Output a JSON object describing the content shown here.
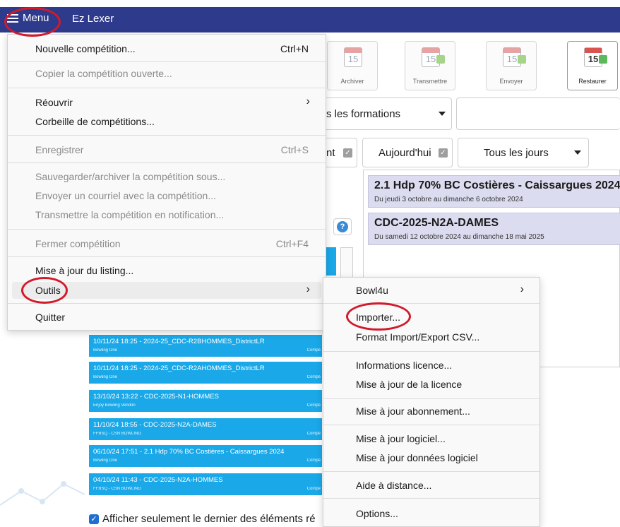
{
  "titlebar": {
    "menu_label": "Menu",
    "app_title": "Ez Lexer"
  },
  "toolbar": [
    {
      "name": "archiver",
      "label": "Archiver",
      "day": "15"
    },
    {
      "name": "transmettre",
      "label": "Transmettre",
      "day": "15"
    },
    {
      "name": "envoyer",
      "label": "Envoyer",
      "day": "15"
    },
    {
      "name": "restaurer",
      "label": "Restaurer",
      "day": "15"
    }
  ],
  "filters": {
    "formations": "s les formations",
    "partial_left": "nt",
    "today": "Aujourd'hui",
    "days": "Tous les jours"
  },
  "competitions": [
    {
      "title": "2.1 Hdp 70% BC Costières - Caissargues 2024",
      "dates": "Du jeudi 3 octobre au dimanche 6 octobre 2024"
    },
    {
      "title": "CDC-2025-N2A-DAMES",
      "dates": "Du samedi 12 octobre 2024 au dimanche 18 mai 2025"
    }
  ],
  "help_glyph": "?",
  "recent_items": [
    {
      "title": "10/11/24 18:25 - 2024-25_CDC-R2BHOMMES_DistrictLR",
      "sub": "Bowling One",
      "right": "Compé"
    },
    {
      "title": "10/11/24 18:25 - 2024-25_CDC-R2AHOMMES_DistrictLR",
      "sub": "Bowling One",
      "right": "Compé"
    },
    {
      "title": "13/10/24 13:22 - CDC-2025-N1-HOMMES",
      "sub": "Enjoy Bowling Vendon",
      "right": "Compé"
    },
    {
      "title": "11/10/24 18:55 - CDC-2025-N2A-DAMES",
      "sub": "FFBSQ - CSN BOWLING",
      "right": "Compé"
    },
    {
      "title": "06/10/24 17:51 - 2.1 Hdp 70% BC Costières - Caissargues 2024",
      "sub": "Bowling One",
      "right": "Compé"
    },
    {
      "title": "04/10/24 11:43 - CDC-2025-N2A-HOMMES",
      "sub": "FFBSQ - CSN BOWLING",
      "right": "Compé"
    }
  ],
  "footer": {
    "show_last_label": "Afficher seulement le dernier des éléments ré"
  },
  "main_menu": {
    "items": [
      {
        "label": "Nouvelle compétition...",
        "shortcut": "Ctrl+N",
        "disabled": false
      },
      {
        "label": "Copier la compétition ouverte...",
        "disabled": true
      },
      {
        "label": "Réouvrir",
        "submenu": true
      },
      {
        "label": "Corbeille de compétitions..."
      },
      {
        "label": "Enregistrer",
        "shortcut": "Ctrl+S",
        "disabled": true
      },
      {
        "label": "Sauvegarder/archiver la compétition sous...",
        "disabled": true
      },
      {
        "label": "Envoyer un courriel avec la compétition...",
        "disabled": true
      },
      {
        "label": "Transmettre la compétition en notification...",
        "disabled": true
      },
      {
        "label": "Fermer compétition",
        "shortcut": "Ctrl+F4",
        "disabled": true
      },
      {
        "label": "Mise à jour du listing..."
      },
      {
        "label": "Outils",
        "submenu": true
      },
      {
        "label": "Quitter"
      }
    ]
  },
  "sub_menu": {
    "items": [
      {
        "label": "Bowl4u",
        "submenu": true
      },
      {
        "label": "Importer..."
      },
      {
        "label": "Format Import/Export CSV..."
      },
      {
        "label": "Informations licence..."
      },
      {
        "label": "Mise à jour de la licence"
      },
      {
        "label": "Mise à jour abonnement..."
      },
      {
        "label": "Mise à jour logiciel..."
      },
      {
        "label": "Mise à jour données logiciel"
      },
      {
        "label": "Aide à distance..."
      },
      {
        "label": "Options..."
      }
    ]
  },
  "glyphs": {
    "chevron": "›",
    "check": "✓"
  },
  "colors": {
    "titlebar": "#2e3a8c",
    "annotation": "#d11a2a",
    "recent_item": "#1aa8e8",
    "competition_card": "#dcdcf0"
  }
}
